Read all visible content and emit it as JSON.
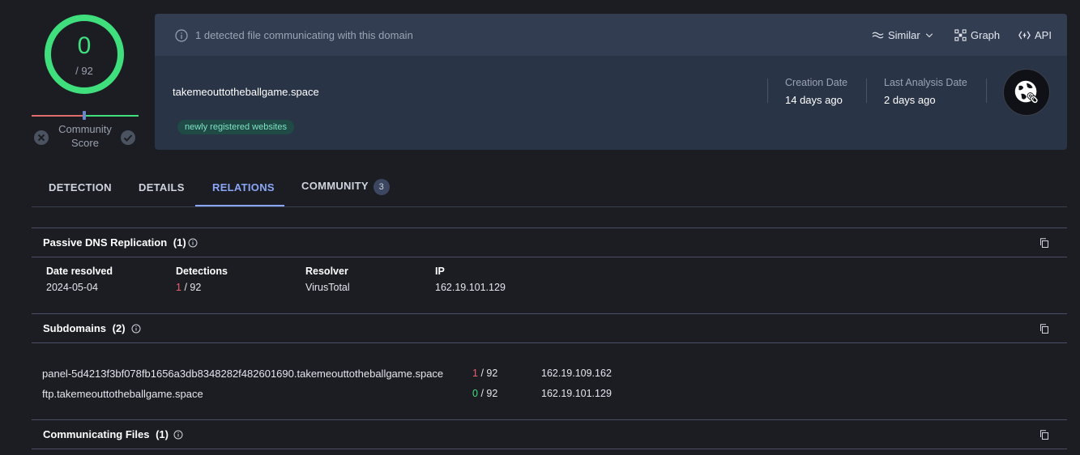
{
  "score": {
    "value": "0",
    "total": "/ 92",
    "community_label": "Community Score"
  },
  "header": {
    "detected_text": "1 detected file communicating with this domain",
    "tools": {
      "similar": "Similar",
      "graph": "Graph",
      "api": "API"
    },
    "domain": "takemeouttotheballgame.space",
    "tag": "newly registered websites",
    "creation_label": "Creation Date",
    "creation_value": "14 days ago",
    "analysis_label": "Last Analysis Date",
    "analysis_value": "2 days ago"
  },
  "tabs": [
    {
      "label": "DETECTION"
    },
    {
      "label": "DETAILS"
    },
    {
      "label": "RELATIONS"
    },
    {
      "label": "COMMUNITY",
      "badge": "3"
    }
  ],
  "passive_dns": {
    "title": "Passive DNS Replication",
    "count": "(1)",
    "columns": [
      "Date resolved",
      "Detections",
      "Resolver",
      "IP"
    ],
    "rows": [
      {
        "date": "2024-05-04",
        "det_pos": "1",
        "det_total": "/ 92",
        "resolver": "VirusTotal",
        "ip": "162.19.101.129"
      }
    ]
  },
  "subdomains": {
    "title": "Subdomains",
    "count": "(2)",
    "rows": [
      {
        "name": "panel-5d4213f3bf078fb1656a3db8348282f482601690.takemeouttotheballgame.space",
        "det_pos": "1",
        "det_total": "/ 92",
        "ip": "162.19.109.162"
      },
      {
        "name": "ftp.takemeouttotheballgame.space",
        "det_pos": "0",
        "det_total": "/ 92",
        "ip": "162.19.101.129"
      }
    ]
  },
  "communicating_files": {
    "title": "Communicating Files",
    "count": "(1)"
  },
  "colors": {
    "accent": "#8aa6f7",
    "malicious": "#e8606a",
    "clean": "#3fdf7e",
    "background": "#1c1d23",
    "card": "#2a3447"
  }
}
